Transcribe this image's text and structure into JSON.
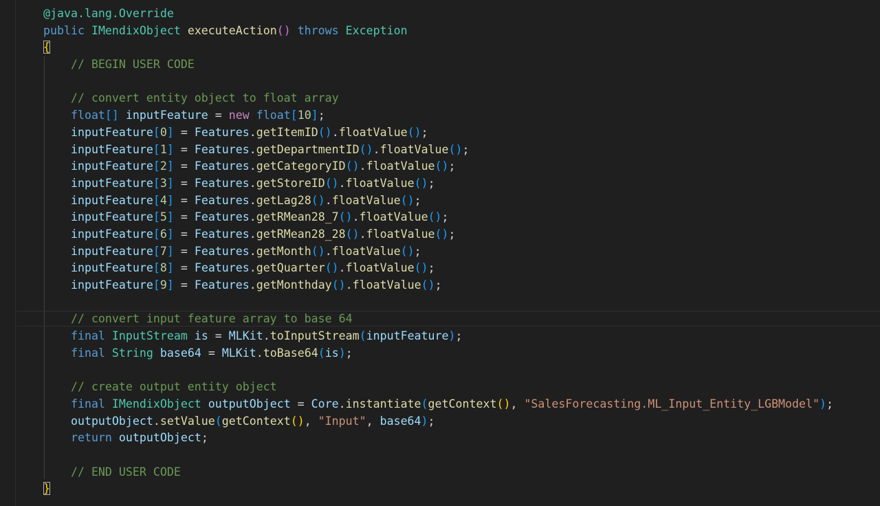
{
  "editor": {
    "language": "java",
    "theme_colors": {
      "background": "#1f1f1f",
      "keyword": "#569cd6",
      "type": "#4ec9b0",
      "function": "#dcdcaa",
      "variable": "#9cdcfe",
      "comment": "#6a9955",
      "number": "#b5cea8",
      "string": "#ce9178",
      "bracket_level_1": "#ffd700",
      "bracket_level_2": "#da70d6",
      "bracket_level_3": "#179fff"
    },
    "lines": [
      [
        [
          "ann",
          "@java.lang.Override"
        ]
      ],
      [
        [
          "kw",
          "public"
        ],
        [
          "op",
          " "
        ],
        [
          "type",
          "IMendixObject"
        ],
        [
          "op",
          " "
        ],
        [
          "fn",
          "executeAction"
        ],
        [
          "p2",
          "()"
        ],
        [
          "op",
          " "
        ],
        [
          "kw",
          "throws"
        ],
        [
          "op",
          " "
        ],
        [
          "type",
          "Exception"
        ]
      ],
      [
        [
          "p1brace",
          "{"
        ]
      ],
      [
        [
          "op",
          "    "
        ],
        [
          "cm",
          "// BEGIN USER CODE"
        ]
      ],
      [
        [
          "op",
          ""
        ]
      ],
      [
        [
          "op",
          "    "
        ],
        [
          "cm",
          "// convert entity object to float array"
        ]
      ],
      [
        [
          "op",
          "    "
        ],
        [
          "kw",
          "float"
        ],
        [
          "p3",
          "[]"
        ],
        [
          "op",
          " "
        ],
        [
          "var",
          "inputFeature"
        ],
        [
          "op",
          " = "
        ],
        [
          "newkw",
          "new"
        ],
        [
          "op",
          " "
        ],
        [
          "kw",
          "float"
        ],
        [
          "p3",
          "["
        ],
        [
          "num",
          "10"
        ],
        [
          "p3",
          "]"
        ],
        [
          "op",
          ";"
        ]
      ],
      [
        [
          "op",
          "    "
        ],
        [
          "var",
          "inputFeature"
        ],
        [
          "p3",
          "["
        ],
        [
          "num",
          "0"
        ],
        [
          "p3",
          "]"
        ],
        [
          "op",
          " = "
        ],
        [
          "var",
          "Features"
        ],
        [
          "op",
          "."
        ],
        [
          "fn",
          "getItemID"
        ],
        [
          "p3",
          "()"
        ],
        [
          "op",
          "."
        ],
        [
          "fn",
          "floatValue"
        ],
        [
          "p3",
          "()"
        ],
        [
          "op",
          ";"
        ]
      ],
      [
        [
          "op",
          "    "
        ],
        [
          "var",
          "inputFeature"
        ],
        [
          "p3",
          "["
        ],
        [
          "num",
          "1"
        ],
        [
          "p3",
          "]"
        ],
        [
          "op",
          " = "
        ],
        [
          "var",
          "Features"
        ],
        [
          "op",
          "."
        ],
        [
          "fn",
          "getDepartmentID"
        ],
        [
          "p3",
          "()"
        ],
        [
          "op",
          "."
        ],
        [
          "fn",
          "floatValue"
        ],
        [
          "p3",
          "()"
        ],
        [
          "op",
          ";"
        ]
      ],
      [
        [
          "op",
          "    "
        ],
        [
          "var",
          "inputFeature"
        ],
        [
          "p3",
          "["
        ],
        [
          "num",
          "2"
        ],
        [
          "p3",
          "]"
        ],
        [
          "op",
          " = "
        ],
        [
          "var",
          "Features"
        ],
        [
          "op",
          "."
        ],
        [
          "fn",
          "getCategoryID"
        ],
        [
          "p3",
          "()"
        ],
        [
          "op",
          "."
        ],
        [
          "fn",
          "floatValue"
        ],
        [
          "p3",
          "()"
        ],
        [
          "op",
          ";"
        ]
      ],
      [
        [
          "op",
          "    "
        ],
        [
          "var",
          "inputFeature"
        ],
        [
          "p3",
          "["
        ],
        [
          "num",
          "3"
        ],
        [
          "p3",
          "]"
        ],
        [
          "op",
          " = "
        ],
        [
          "var",
          "Features"
        ],
        [
          "op",
          "."
        ],
        [
          "fn",
          "getStoreID"
        ],
        [
          "p3",
          "()"
        ],
        [
          "op",
          "."
        ],
        [
          "fn",
          "floatValue"
        ],
        [
          "p3",
          "()"
        ],
        [
          "op",
          ";"
        ]
      ],
      [
        [
          "op",
          "    "
        ],
        [
          "var",
          "inputFeature"
        ],
        [
          "p3",
          "["
        ],
        [
          "num",
          "4"
        ],
        [
          "p3",
          "]"
        ],
        [
          "op",
          " = "
        ],
        [
          "var",
          "Features"
        ],
        [
          "op",
          "."
        ],
        [
          "fn",
          "getLag28"
        ],
        [
          "p3",
          "()"
        ],
        [
          "op",
          "."
        ],
        [
          "fn",
          "floatValue"
        ],
        [
          "p3",
          "()"
        ],
        [
          "op",
          ";"
        ]
      ],
      [
        [
          "op",
          "    "
        ],
        [
          "var",
          "inputFeature"
        ],
        [
          "p3",
          "["
        ],
        [
          "num",
          "5"
        ],
        [
          "p3",
          "]"
        ],
        [
          "op",
          " = "
        ],
        [
          "var",
          "Features"
        ],
        [
          "op",
          "."
        ],
        [
          "fn",
          "getRMean28_7"
        ],
        [
          "p3",
          "()"
        ],
        [
          "op",
          "."
        ],
        [
          "fn",
          "floatValue"
        ],
        [
          "p3",
          "()"
        ],
        [
          "op",
          ";"
        ]
      ],
      [
        [
          "op",
          "    "
        ],
        [
          "var",
          "inputFeature"
        ],
        [
          "p3",
          "["
        ],
        [
          "num",
          "6"
        ],
        [
          "p3",
          "]"
        ],
        [
          "op",
          " = "
        ],
        [
          "var",
          "Features"
        ],
        [
          "op",
          "."
        ],
        [
          "fn",
          "getRMean28_28"
        ],
        [
          "p3",
          "()"
        ],
        [
          "op",
          "."
        ],
        [
          "fn",
          "floatValue"
        ],
        [
          "p3",
          "()"
        ],
        [
          "op",
          ";"
        ]
      ],
      [
        [
          "op",
          "    "
        ],
        [
          "var",
          "inputFeature"
        ],
        [
          "p3",
          "["
        ],
        [
          "num",
          "7"
        ],
        [
          "p3",
          "]"
        ],
        [
          "op",
          " = "
        ],
        [
          "var",
          "Features"
        ],
        [
          "op",
          "."
        ],
        [
          "fn",
          "getMonth"
        ],
        [
          "p3",
          "()"
        ],
        [
          "op",
          "."
        ],
        [
          "fn",
          "floatValue"
        ],
        [
          "p3",
          "()"
        ],
        [
          "op",
          ";"
        ]
      ],
      [
        [
          "op",
          "    "
        ],
        [
          "var",
          "inputFeature"
        ],
        [
          "p3",
          "["
        ],
        [
          "num",
          "8"
        ],
        [
          "p3",
          "]"
        ],
        [
          "op",
          " = "
        ],
        [
          "var",
          "Features"
        ],
        [
          "op",
          "."
        ],
        [
          "fn",
          "getQuarter"
        ],
        [
          "p3",
          "()"
        ],
        [
          "op",
          "."
        ],
        [
          "fn",
          "floatValue"
        ],
        [
          "p3",
          "()"
        ],
        [
          "op",
          ";"
        ]
      ],
      [
        [
          "op",
          "    "
        ],
        [
          "var",
          "inputFeature"
        ],
        [
          "p3",
          "["
        ],
        [
          "num",
          "9"
        ],
        [
          "p3",
          "]"
        ],
        [
          "op",
          " = "
        ],
        [
          "var",
          "Features"
        ],
        [
          "op",
          "."
        ],
        [
          "fn",
          "getMonthday"
        ],
        [
          "p3",
          "()"
        ],
        [
          "op",
          "."
        ],
        [
          "fn",
          "floatValue"
        ],
        [
          "p3",
          "()"
        ],
        [
          "op",
          ";"
        ]
      ],
      [
        [
          "op",
          ""
        ]
      ],
      [
        [
          "op",
          "    "
        ],
        [
          "cm",
          "// convert input feature array to base 64"
        ]
      ],
      [
        [
          "op",
          "    "
        ],
        [
          "kw",
          "final"
        ],
        [
          "op",
          " "
        ],
        [
          "type",
          "InputStream"
        ],
        [
          "op",
          " "
        ],
        [
          "var",
          "is"
        ],
        [
          "op",
          " = "
        ],
        [
          "var",
          "MLKit"
        ],
        [
          "op",
          "."
        ],
        [
          "fn",
          "toInputStream"
        ],
        [
          "p3",
          "("
        ],
        [
          "var",
          "inputFeature"
        ],
        [
          "p3",
          ")"
        ],
        [
          "op",
          ";"
        ]
      ],
      [
        [
          "op",
          "    "
        ],
        [
          "kw",
          "final"
        ],
        [
          "op",
          " "
        ],
        [
          "type",
          "String"
        ],
        [
          "op",
          " "
        ],
        [
          "var",
          "base64"
        ],
        [
          "op",
          " = "
        ],
        [
          "var",
          "MLKit"
        ],
        [
          "op",
          "."
        ],
        [
          "fn",
          "toBase64"
        ],
        [
          "p3",
          "("
        ],
        [
          "var",
          "is"
        ],
        [
          "p3",
          ")"
        ],
        [
          "op",
          ";"
        ]
      ],
      [
        [
          "op",
          ""
        ]
      ],
      [
        [
          "op",
          "    "
        ],
        [
          "cm",
          "// create output entity object"
        ]
      ],
      [
        [
          "op",
          "    "
        ],
        [
          "kw",
          "final"
        ],
        [
          "op",
          " "
        ],
        [
          "type",
          "IMendixObject"
        ],
        [
          "op",
          " "
        ],
        [
          "var",
          "outputObject"
        ],
        [
          "op",
          " = "
        ],
        [
          "var",
          "Core"
        ],
        [
          "op",
          "."
        ],
        [
          "fn",
          "instantiate"
        ],
        [
          "p3",
          "("
        ],
        [
          "fn",
          "getContext"
        ],
        [
          "p1",
          "()"
        ],
        [
          "op",
          ", "
        ],
        [
          "str",
          "\"SalesForecasting.ML_Input_Entity_LGBModel\""
        ],
        [
          "p3",
          ")"
        ],
        [
          "op",
          ";"
        ]
      ],
      [
        [
          "op",
          "    "
        ],
        [
          "var",
          "outputObject"
        ],
        [
          "op",
          "."
        ],
        [
          "fn",
          "setValue"
        ],
        [
          "p3",
          "("
        ],
        [
          "fn",
          "getContext"
        ],
        [
          "p1",
          "()"
        ],
        [
          "op",
          ", "
        ],
        [
          "str",
          "\"Input\""
        ],
        [
          "op",
          ", "
        ],
        [
          "var",
          "base64"
        ],
        [
          "p3",
          ")"
        ],
        [
          "op",
          ";"
        ]
      ],
      [
        [
          "op",
          "    "
        ],
        [
          "kw",
          "return"
        ],
        [
          "op",
          " "
        ],
        [
          "var",
          "outputObject"
        ],
        [
          "op",
          ";"
        ]
      ],
      [
        [
          "op",
          ""
        ]
      ],
      [
        [
          "op",
          "    "
        ],
        [
          "cm",
          "// END USER CODE"
        ]
      ],
      [
        [
          "p1brace",
          "}"
        ]
      ]
    ]
  }
}
